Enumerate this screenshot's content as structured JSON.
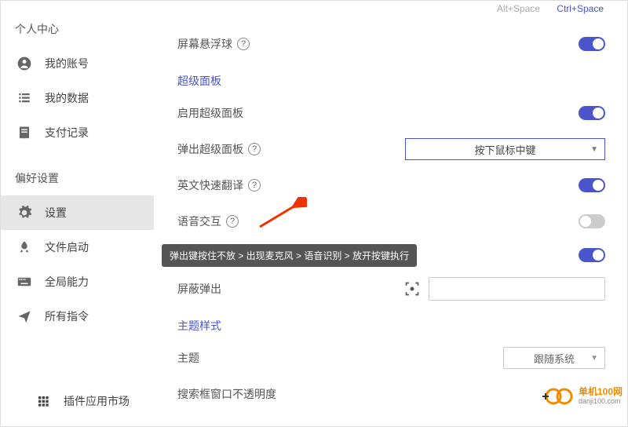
{
  "sidebar": {
    "section1_title": "个人中心",
    "section2_title": "偏好设置",
    "items1": [
      {
        "label": "我的账号"
      },
      {
        "label": "我的数据"
      },
      {
        "label": "支付记录"
      }
    ],
    "items2": [
      {
        "label": "设置"
      },
      {
        "label": "文件启动"
      },
      {
        "label": "全局能力"
      },
      {
        "label": "所有指令"
      }
    ],
    "bottom": {
      "label": "插件应用市场"
    }
  },
  "shortcuts": {
    "inactive": "Alt+Space",
    "active": "Ctrl+Space"
  },
  "rows": {
    "floatball": "屏幕悬浮球",
    "group_panel": "超级面板",
    "enable_panel": "启用超级面板",
    "popup_panel": "弹出超级面板",
    "popup_panel_value": "按下鼠标中键",
    "en_translate": "英文快速翻译",
    "voice": "语音交互",
    "shield": "屏蔽弹出",
    "group_theme": "主题样式",
    "theme": "主题",
    "theme_value": "跟随系统",
    "opacity": "搜索框窗口不透明度"
  },
  "tooltip": "弹出键按住不放 > 出现麦克风 > 语音识别 > 放开按键执行",
  "watermark": {
    "cn": "单机100网",
    "url": "danji100.com"
  }
}
